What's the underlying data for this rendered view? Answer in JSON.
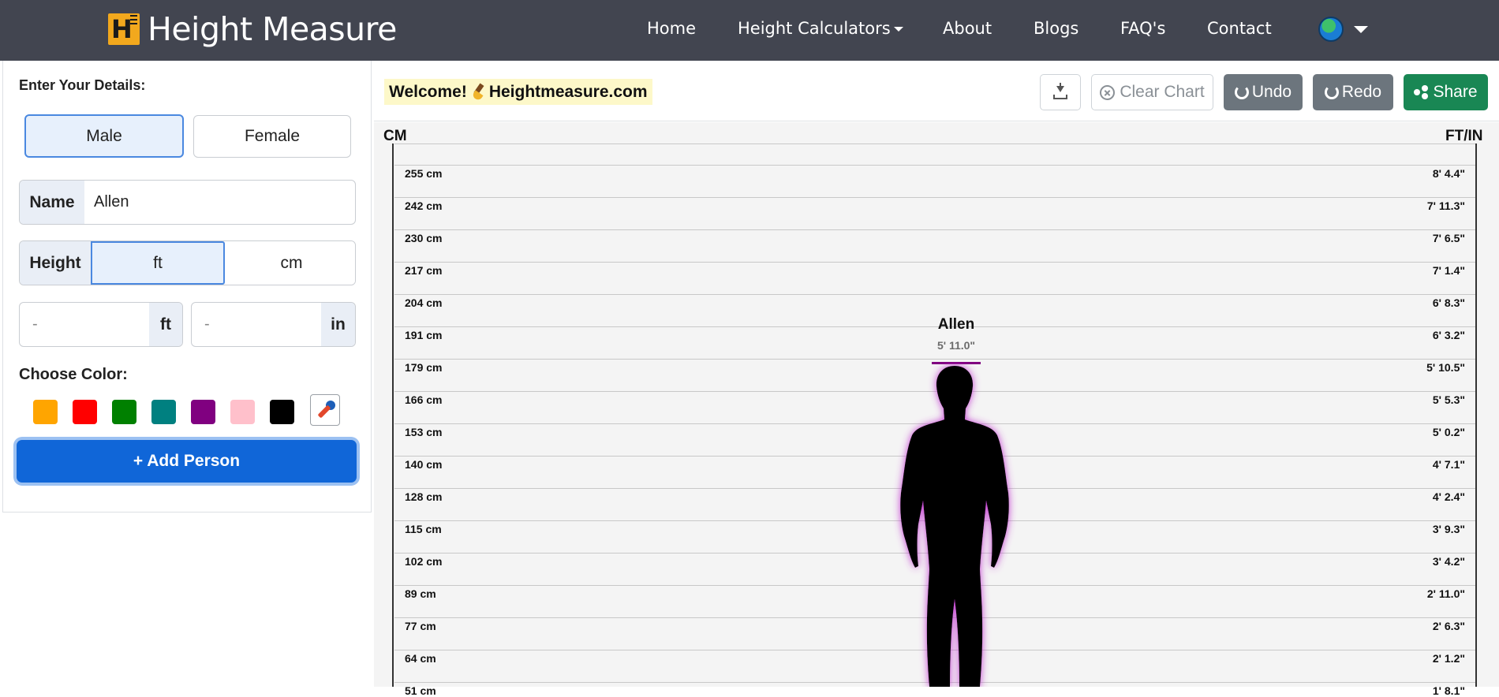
{
  "navbar": {
    "brand": "Height Measure",
    "links": [
      "Home",
      "Height Calculators",
      "About",
      "Blogs",
      "FAQ's",
      "Contact"
    ]
  },
  "form": {
    "heading": "Enter Your Details:",
    "gender_male": "Male",
    "gender_female": "Female",
    "name_label": "Name",
    "name_value": "Allen",
    "height_label": "Height",
    "unit_ft": "ft",
    "unit_cm": "cm",
    "ft_placeholder": "-",
    "in_placeholder": "-",
    "ft_addon": "ft",
    "in_addon": "in",
    "color_label": "Choose Color:",
    "colors": [
      "#ffa500",
      "#ff0000",
      "#008000",
      "#008080",
      "#800080",
      "#ffc0cb",
      "#000000"
    ],
    "add_button": "+ Add Person"
  },
  "toolbar": {
    "welcome": "Welcome!",
    "site": "Heightmeasure.com",
    "clear": "Clear Chart",
    "undo": "Undo",
    "redo": "Redo",
    "share": "Share"
  },
  "chart": {
    "left_title": "CM",
    "right_title": "FT/IN",
    "ticks_cm": [
      "255 cm",
      "242 cm",
      "230 cm",
      "217 cm",
      "204 cm",
      "191 cm",
      "179 cm",
      "166 cm",
      "153 cm",
      "140 cm",
      "128 cm",
      "115 cm",
      "102 cm",
      "89 cm",
      "77 cm",
      "64 cm",
      "51 cm"
    ],
    "ticks_ft": [
      "8' 4.4\"",
      "7' 11.3\"",
      "7' 6.5\"",
      "7' 1.4\"",
      "6' 8.3\"",
      "6' 3.2\"",
      "5' 10.5\"",
      "5' 5.3\"",
      "5' 0.2\"",
      "4' 7.1\"",
      "4' 2.4\"",
      "3' 9.3\"",
      "3' 4.2\"",
      "2' 11.0\"",
      "2' 6.3\"",
      "2' 1.2\"",
      "1' 8.1\""
    ],
    "person": {
      "name": "Allen",
      "height": "5' 11.0\"",
      "color": "#800080"
    }
  }
}
